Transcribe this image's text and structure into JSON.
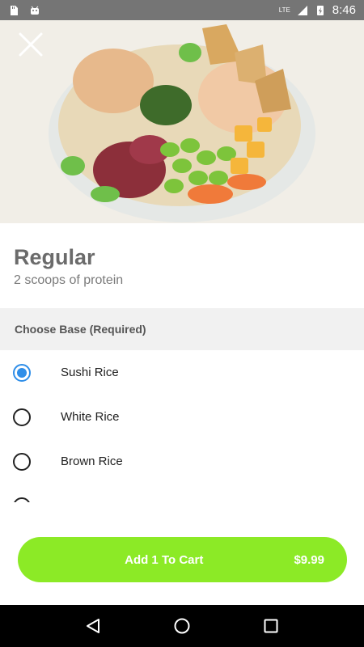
{
  "status_bar": {
    "time": "8:46",
    "network": "LTE",
    "icons": [
      "sd-card-icon",
      "android-icon",
      "signal-icon",
      "battery-icon"
    ]
  },
  "hero": {
    "alt_icon": "close-icon"
  },
  "item": {
    "title": "Regular",
    "subtitle": "2 scoops of protein"
  },
  "section": {
    "title": "Choose Base (Required)"
  },
  "options": [
    {
      "label": "Sushi Rice",
      "checked": true
    },
    {
      "label": "White Rice",
      "checked": false
    },
    {
      "label": "Brown Rice",
      "checked": false
    }
  ],
  "cart": {
    "label": "Add 1 To Cart",
    "price": "$9.99"
  },
  "colors": {
    "accent": "#8cea26",
    "radio_selected": "#2f8ee8"
  }
}
